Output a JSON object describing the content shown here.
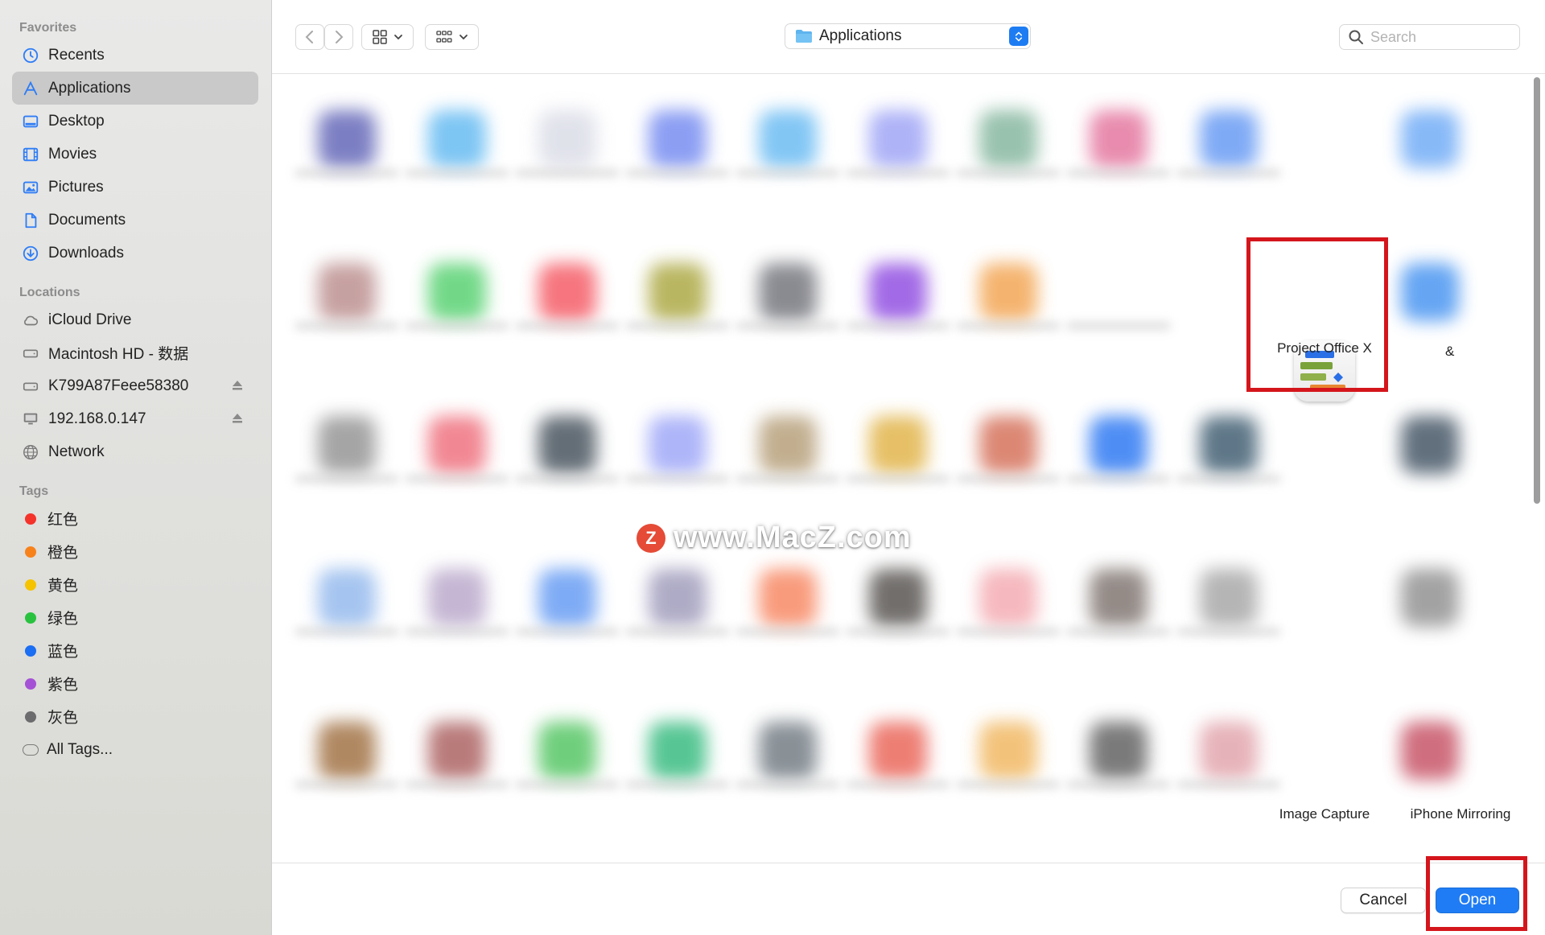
{
  "sidebar": {
    "favorites_header": "Favorites",
    "favorites": [
      {
        "label": "Recents",
        "icon": "clock-icon"
      },
      {
        "label": "Applications",
        "icon": "applications-icon"
      },
      {
        "label": "Desktop",
        "icon": "desktop-icon"
      },
      {
        "label": "Movies",
        "icon": "film-icon"
      },
      {
        "label": "Pictures",
        "icon": "photo-icon"
      },
      {
        "label": "Documents",
        "icon": "document-icon"
      },
      {
        "label": "Downloads",
        "icon": "download-icon"
      }
    ],
    "locations_header": "Locations",
    "locations": [
      {
        "label": "iCloud Drive",
        "icon": "cloud-icon"
      },
      {
        "label": "Macintosh HD - 数据",
        "icon": "drive-icon"
      },
      {
        "label": "K799A87Feee58380",
        "icon": "drive-icon"
      },
      {
        "label": "192.168.0.147",
        "icon": "monitor-icon"
      },
      {
        "label": "Network",
        "icon": "globe-icon"
      }
    ],
    "tags_header": "Tags",
    "tags": [
      {
        "label": "红色",
        "color": "#f4332b"
      },
      {
        "label": "橙色",
        "color": "#f7821b"
      },
      {
        "label": "黄色",
        "color": "#f5c300"
      },
      {
        "label": "绿色",
        "color": "#29c23f"
      },
      {
        "label": "蓝色",
        "color": "#1c6ef2"
      },
      {
        "label": "紫色",
        "color": "#a551d6"
      },
      {
        "label": "灰色",
        "color": "#6c6c6e"
      }
    ],
    "all_tags": "All Tags..."
  },
  "toolbar": {
    "location": "Applications",
    "search_placeholder": "Search"
  },
  "apps": {
    "project_office": "Project Office X",
    "image_capture": "Image Capture",
    "iphone_mirroring": "iPhone Mirroring",
    "partial_amp": "&"
  },
  "watermark": {
    "logo": "Z",
    "text": "www.MacZ.com"
  },
  "footer": {
    "cancel": "Cancel",
    "open": "Open"
  },
  "colors": {
    "accent": "#1f7cf4",
    "highlight": "#d4161c"
  }
}
